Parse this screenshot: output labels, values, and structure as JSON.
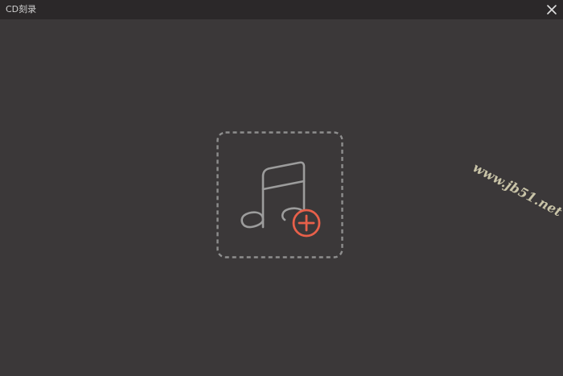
{
  "window": {
    "title": "CD刻录"
  },
  "icons": {
    "close": "close-icon",
    "music": "music-note-icon",
    "add": "add-circle-icon"
  },
  "colors": {
    "background": "#3b3839",
    "titlebar": "#2b2829",
    "icon_gray": "#9c9c9c",
    "accent": "#e8604a"
  },
  "watermark": {
    "text": "www.jb51.net"
  }
}
